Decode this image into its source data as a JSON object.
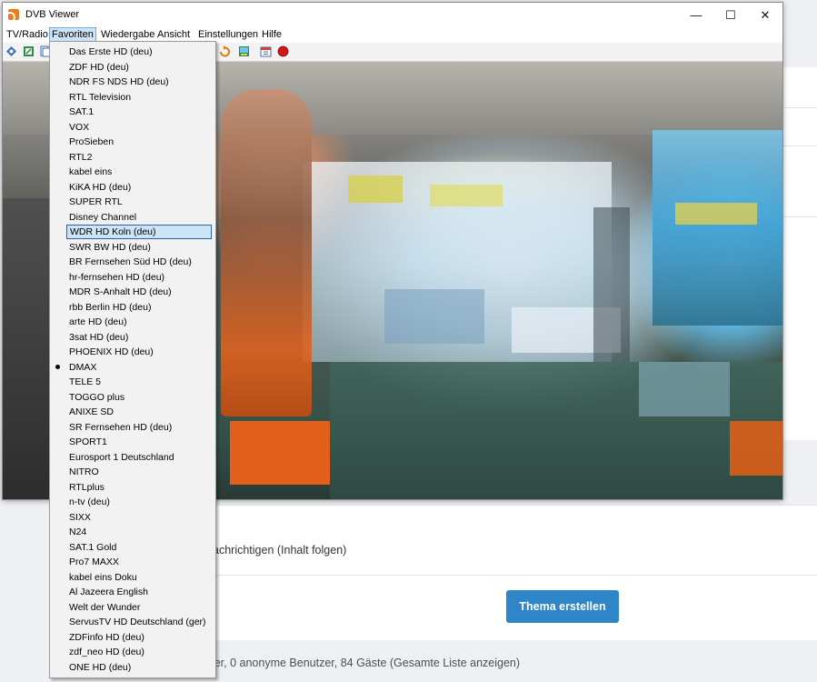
{
  "webpage": {
    "notify_text": "achrichtigen (Inhalt folgen)",
    "create_button": "Thema erstellen",
    "footer_text": "tzer, 0 anonyme Benutzer, 84 Gäste (Gesamte Liste anzeigen)"
  },
  "window": {
    "title": "DVB Viewer",
    "controls": {
      "minimize": "—",
      "maximize": "☐",
      "close": "✕"
    }
  },
  "menu": {
    "items": [
      "TV/Radio",
      "Favoriten",
      "Wiedergabe",
      "Ansicht",
      "Einstellungen",
      "Hilfe"
    ],
    "active": "Favoriten"
  },
  "toolbar": {
    "icons": [
      "home-icon",
      "edit-icon",
      "copy-icon",
      "refresh-icon",
      "record-list-icon",
      "schedule-icon",
      "record-icon"
    ],
    "record_color": "#d01818"
  },
  "favorites": {
    "items": [
      "Das Erste HD (deu)",
      "ZDF HD (deu)",
      "NDR FS NDS HD (deu)",
      "RTL Television",
      "SAT.1",
      "VOX",
      "ProSieben",
      "RTL2",
      "kabel eins",
      "KiKA HD (deu)",
      "SUPER RTL",
      "Disney Channel",
      "WDR HD Koln (deu)",
      "SWR BW HD (deu)",
      "BR Fernsehen Süd HD (deu)",
      "hr-fernsehen HD (deu)",
      "MDR S-Anhalt HD (deu)",
      "rbb Berlin HD (deu)",
      "arte HD (deu)",
      "3sat HD (deu)",
      "PHOENIX HD (deu)",
      "DMAX",
      "TELE 5",
      "TOGGO plus",
      "ANIXE SD",
      "SR Fernsehen HD (deu)",
      "SPORT1",
      "Eurosport 1 Deutschland",
      "NITRO",
      "RTLplus",
      "n-tv (deu)",
      "SIXX",
      "N24",
      "SAT.1 Gold",
      "Pro7 MAXX",
      "kabel eins Doku",
      "Al Jazeera English",
      "Welt der Wunder",
      "ServusTV HD Deutschland (ger)",
      "ZDFinfo HD (deu)",
      "zdf_neo HD (deu)",
      "ONE HD (deu)"
    ],
    "hovered": "WDR HD Koln (deu)",
    "checked": "DMAX"
  },
  "colors": {
    "accent_button": "#2e86c8",
    "menu_highlight": "#cce4f7",
    "app_icon": "#ee7c1e"
  }
}
